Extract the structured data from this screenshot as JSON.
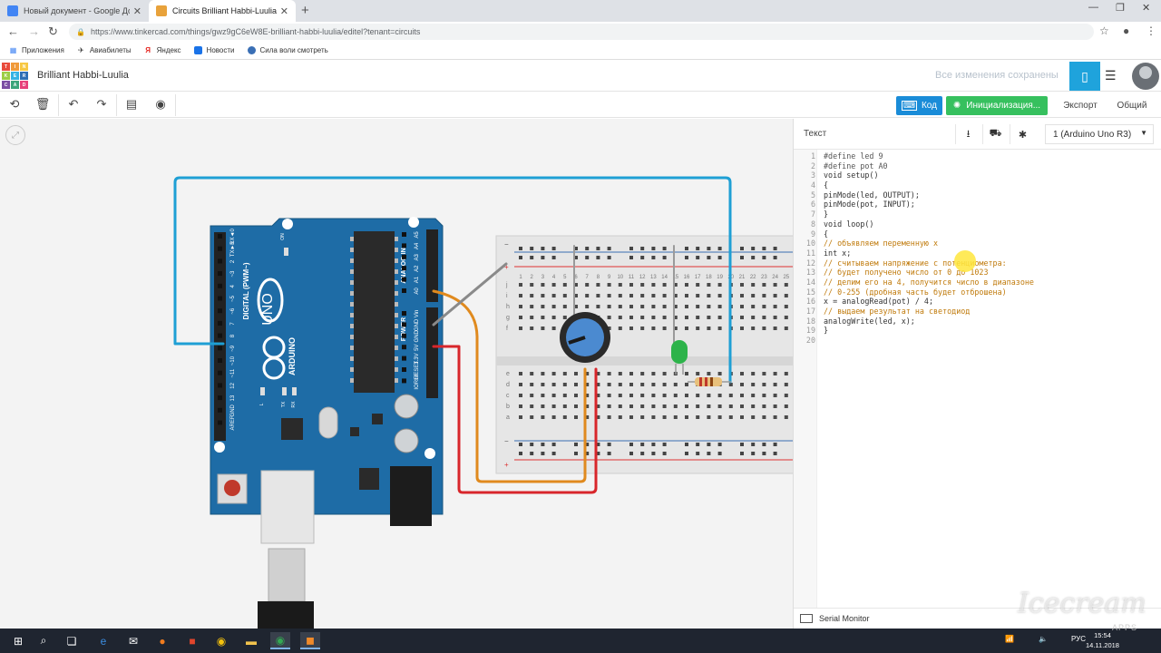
{
  "browser": {
    "tabs": [
      {
        "title": "Новый документ - Google Доку",
        "favicon_color": "#4285f4"
      },
      {
        "title": "Circuits Brilliant Habbi-Luulia | Ti",
        "favicon_color": "#e8a23b"
      }
    ],
    "url": "https://www.tinkercad.com/things/gwz9gC6eW8E-brilliant-habbi-luulia/editel?tenant=circuits",
    "bookmarks": [
      "Приложения",
      "Авиабилеты",
      "Яндекс",
      "Новости",
      "Сила воли смотреть"
    ]
  },
  "header": {
    "logo_letters": [
      "TIN",
      "KER",
      "CAD"
    ],
    "project_name": "Brilliant Habbi-Luulia",
    "save_status": "Все изменения сохранены"
  },
  "toolbar": {
    "code_label": "Код",
    "init_label": "Инициализация...",
    "export_label": "Экспорт",
    "share_label": "Общий"
  },
  "code_panel": {
    "label": "Текст",
    "device": "1 (Arduino Uno R3)",
    "lines": [
      {
        "n": "1",
        "t": "#define led 9",
        "k": "pp"
      },
      {
        "n": "2",
        "t": "#define pot A0",
        "k": "pp"
      },
      {
        "n": "3",
        "t": "void setup()",
        "k": "kw"
      },
      {
        "n": "4",
        "t": "{",
        "k": "kw"
      },
      {
        "n": "5",
        "t": "pinMode(led, OUTPUT);",
        "k": "kw"
      },
      {
        "n": "6",
        "t": "pinMode(pot, INPUT);",
        "k": "kw"
      },
      {
        "n": "7",
        "t": "}",
        "k": "kw"
      },
      {
        "n": "8",
        "t": "void loop()",
        "k": "kw"
      },
      {
        "n": "9",
        "t": "{",
        "k": "kw"
      },
      {
        "n": "10",
        "t": "// объявляем переменную x",
        "k": "cm"
      },
      {
        "n": "11",
        "t": "int x;",
        "k": "kw"
      },
      {
        "n": "12",
        "t": "// считываем напряжение с потенциометра:",
        "k": "cm"
      },
      {
        "n": "13",
        "t": "// будет получено число от 0 до 1023",
        "k": "cm"
      },
      {
        "n": "14",
        "t": "// делим его на 4, получится число в диапазоне",
        "k": "cm"
      },
      {
        "n": "15",
        "t": "// 0-255 (дробная часть будет отброшена)",
        "k": "cm"
      },
      {
        "n": "16",
        "t": "x = analogRead(pot) / 4;",
        "k": "kw"
      },
      {
        "n": "17",
        "t": "// выдаем результат на светодиод",
        "k": "cm"
      },
      {
        "n": "18",
        "t": "analogWrite(led, x);",
        "k": "kw"
      },
      {
        "n": "19",
        "t": "}",
        "k": "kw"
      },
      {
        "n": "20",
        "t": "",
        "k": "kw"
      }
    ],
    "serial_monitor_label": "Serial Monitor"
  },
  "circuit": {
    "board_texts": {
      "uno": "UNO",
      "arduino": "ARDUINO",
      "digital": "DIGITAL (PWM~)",
      "analog_in": "ANALOG IN",
      "power": "POWER",
      "digital_pins": [
        "RX◄0",
        "TX►1",
        "2",
        "~3",
        "4",
        "~5",
        "~6",
        "7",
        "8",
        "~9",
        "~10",
        "~11",
        "12",
        "13",
        "GND",
        "AREF"
      ],
      "analog_pins": [
        "A5",
        "A4",
        "A3",
        "A2",
        "A1",
        "A0"
      ],
      "power_pins": [
        "Vin",
        "GND",
        "GND",
        "5V",
        "3.3V",
        "RESET",
        "IOREF"
      ],
      "leds": [
        "L",
        "TX",
        "RX"
      ],
      "on_label": "ON"
    },
    "breadboard": {
      "columns": 25,
      "rows_top": [
        "j",
        "i",
        "h",
        "g",
        "f"
      ],
      "rows_bottom": [
        "e",
        "d",
        "c",
        "b",
        "a"
      ]
    },
    "wire_colors": {
      "blue": "#1e9fd4",
      "orange": "#e08a1e",
      "red": "#d8262b",
      "gray": "#8a8a8a"
    }
  },
  "taskbar": {
    "lang": "РУС",
    "time": "15:54",
    "date": "14.11.2018"
  },
  "watermark": {
    "text": "Icecream",
    "sub": "APPS"
  }
}
